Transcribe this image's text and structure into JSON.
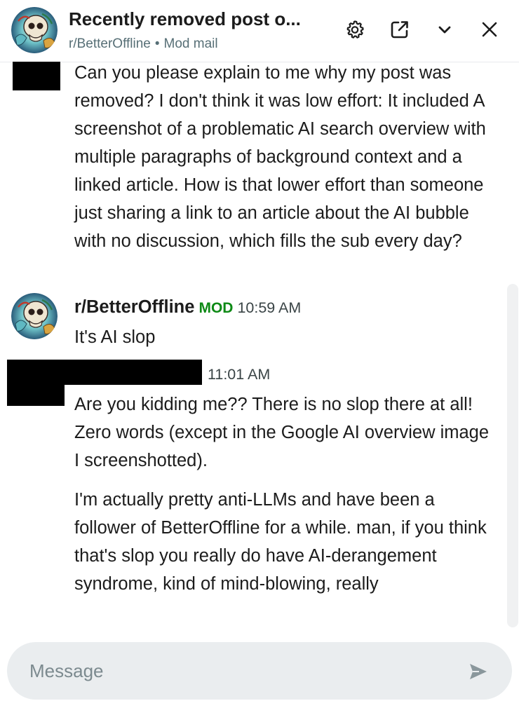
{
  "header": {
    "title": "Recently removed post o...",
    "subreddit": "r/BetterOffline",
    "separator": "•",
    "context": "Mod mail",
    "icons": {
      "settings": "gear-icon",
      "popout": "external-link-icon",
      "collapse": "chevron-down-icon",
      "close": "close-icon"
    }
  },
  "messages": [
    {
      "author": "",
      "redacted": true,
      "paragraphs": [
        "Can you please explain to me why my post was removed? I don't think it was low effort: It included A screenshot of a problematic AI search overview with multiple paragraphs of background context and a linked article. How is that lower effort than someone just sharing a link to an article about the AI bubble with no discussion, which fills the sub every day?"
      ]
    },
    {
      "author": "r/BetterOffline",
      "badge": "MOD",
      "time": "10:59 AM",
      "paragraphs": [
        "It's AI slop"
      ]
    },
    {
      "author": "",
      "redacted": true,
      "time": "11:01 AM",
      "paragraphs": [
        "Are you kidding me?? There is no slop there at all! Zero words (except in the Google AI overview image I screenshotted).",
        "I'm actually pretty anti-LLMs and have been a follower of BetterOffline for a while. man, if you think that's slop you really do have AI-derangement syndrome, kind of mind-blowing, really"
      ]
    }
  ],
  "composer": {
    "placeholder": "Message",
    "send_icon": "send-icon"
  },
  "colors": {
    "mod_badge": "#0e8a16",
    "subtext": "#576f76",
    "composer_bg": "#eaedef",
    "placeholder": "#7c8a8f"
  }
}
